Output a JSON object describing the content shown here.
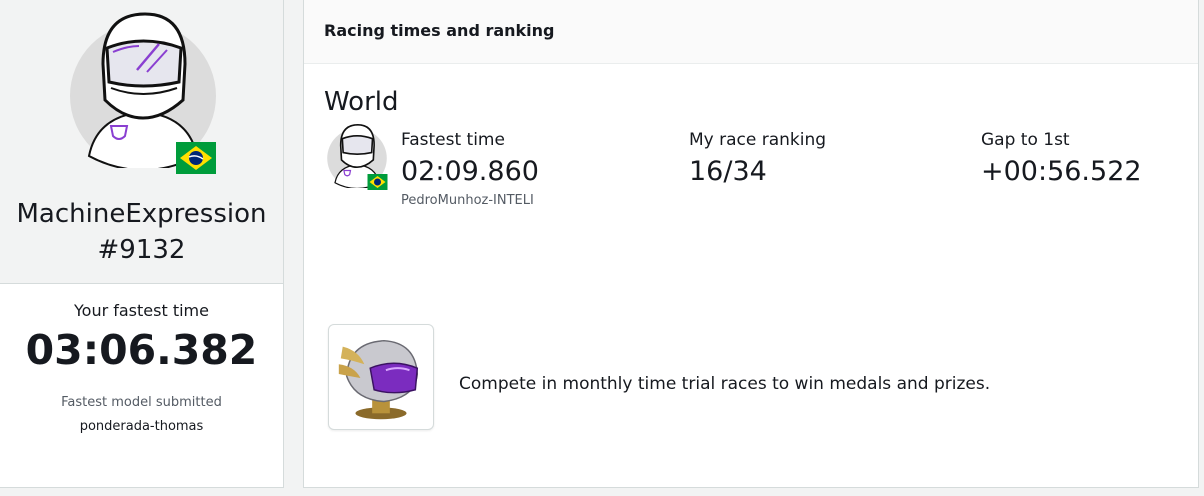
{
  "profile": {
    "avatar_icon": "racer-helmet-avatar-icon",
    "flag_icon": "brazil-flag-icon",
    "username": "MachineExpression",
    "tag": "#9132",
    "fastest_label": "Your fastest time",
    "fastest_value": "03:06.382",
    "model_label": "Fastest model submitted",
    "model_value": "ponderada-thomas"
  },
  "racing": {
    "header_title": "Racing times and ranking",
    "section_title": "World",
    "fastest": {
      "label": "Fastest time",
      "value": "02:09.860",
      "holder": "PedroMunhoz-INTELI"
    },
    "ranking": {
      "label": "My race ranking",
      "value": "16/34"
    },
    "gap": {
      "label": "Gap to 1st",
      "value": "+00:56.522"
    },
    "promo": {
      "icon": "medal-helmet-trophy-icon",
      "text": "Compete in monthly time trial races to win medals and prizes."
    }
  },
  "colors": {
    "accent_purple": "#8a3fd1",
    "flag_green": "#009c3b",
    "flag_yellow": "#ffdf00",
    "flag_blue": "#002776"
  }
}
